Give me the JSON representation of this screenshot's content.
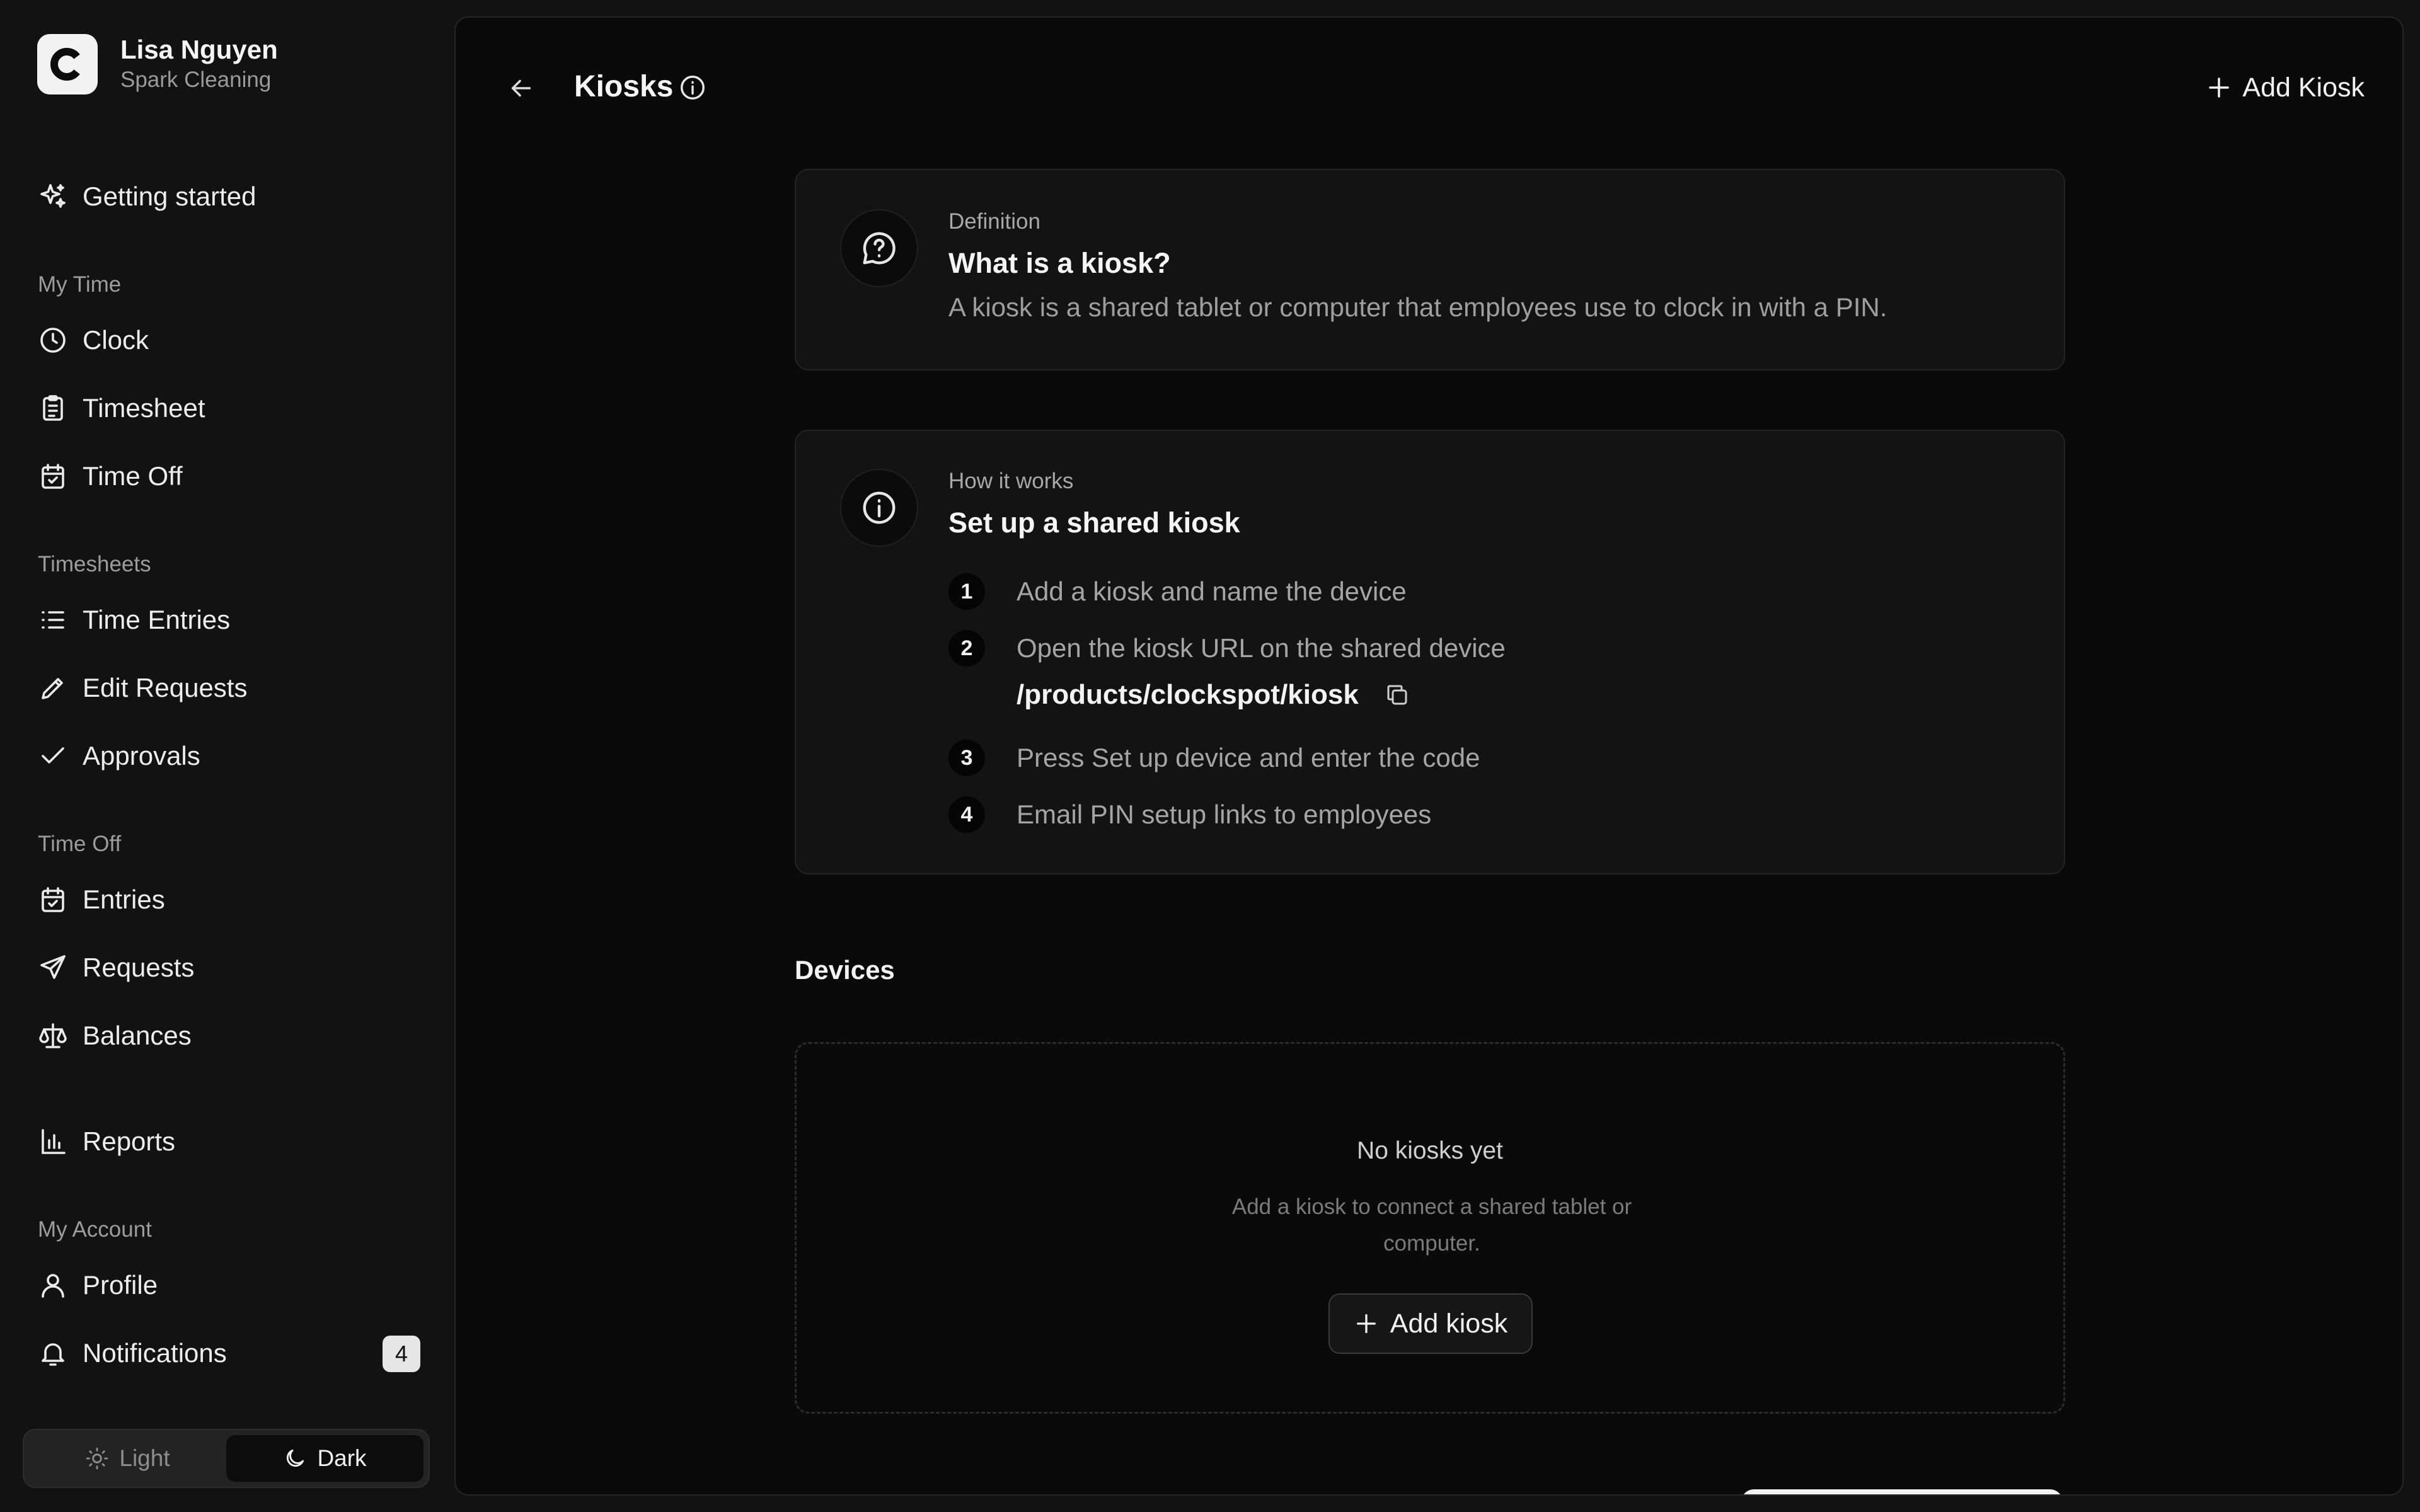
{
  "user": {
    "name": "Lisa Nguyen",
    "org": "Spark Cleaning",
    "logo_letter": "C"
  },
  "sidebar": {
    "getting_started": "Getting started",
    "sections": {
      "my_time": "My Time",
      "timesheets": "Timesheets",
      "time_off": "Time Off",
      "my_account": "My Account"
    },
    "items": {
      "clock": "Clock",
      "timesheet": "Timesheet",
      "time_off": "Time Off",
      "time_entries": "Time Entries",
      "edit_requests": "Edit Requests",
      "approvals": "Approvals",
      "entries": "Entries",
      "requests": "Requests",
      "balances": "Balances",
      "reports": "Reports",
      "profile": "Profile",
      "notifications": "Notifications"
    },
    "notifications_count": "4",
    "theme": {
      "light": "Light",
      "dark": "Dark",
      "selected": "Dark"
    }
  },
  "header": {
    "title": "Kiosks",
    "add_label": "Add Kiosk"
  },
  "definition": {
    "kicker": "Definition",
    "heading": "What is a kiosk?",
    "text": "A kiosk is a shared tablet or computer that employees use to clock in with a PIN."
  },
  "how_it_works": {
    "kicker": "How it works",
    "heading": "Set up a shared kiosk",
    "steps": [
      {
        "num": "1",
        "text": "Add a kiosk and name the device"
      },
      {
        "num": "2",
        "text": "Open the kiosk URL on the shared device"
      },
      {
        "num": "3",
        "text": "Press Set up device and enter the code"
      },
      {
        "num": "4",
        "text": "Email PIN setup links to employees"
      }
    ],
    "url": "/products/clockspot/kiosk"
  },
  "devices": {
    "title": "Devices",
    "empty_title": "No kiosks yet",
    "empty_desc": "Add a kiosk to connect a shared tablet or computer.",
    "add_label": "Add kiosk"
  },
  "colors": {
    "background": "#121212",
    "panel": "#0a0a0a",
    "card": "#131313",
    "text": "#ececec",
    "muted": "#9e9e9e"
  }
}
